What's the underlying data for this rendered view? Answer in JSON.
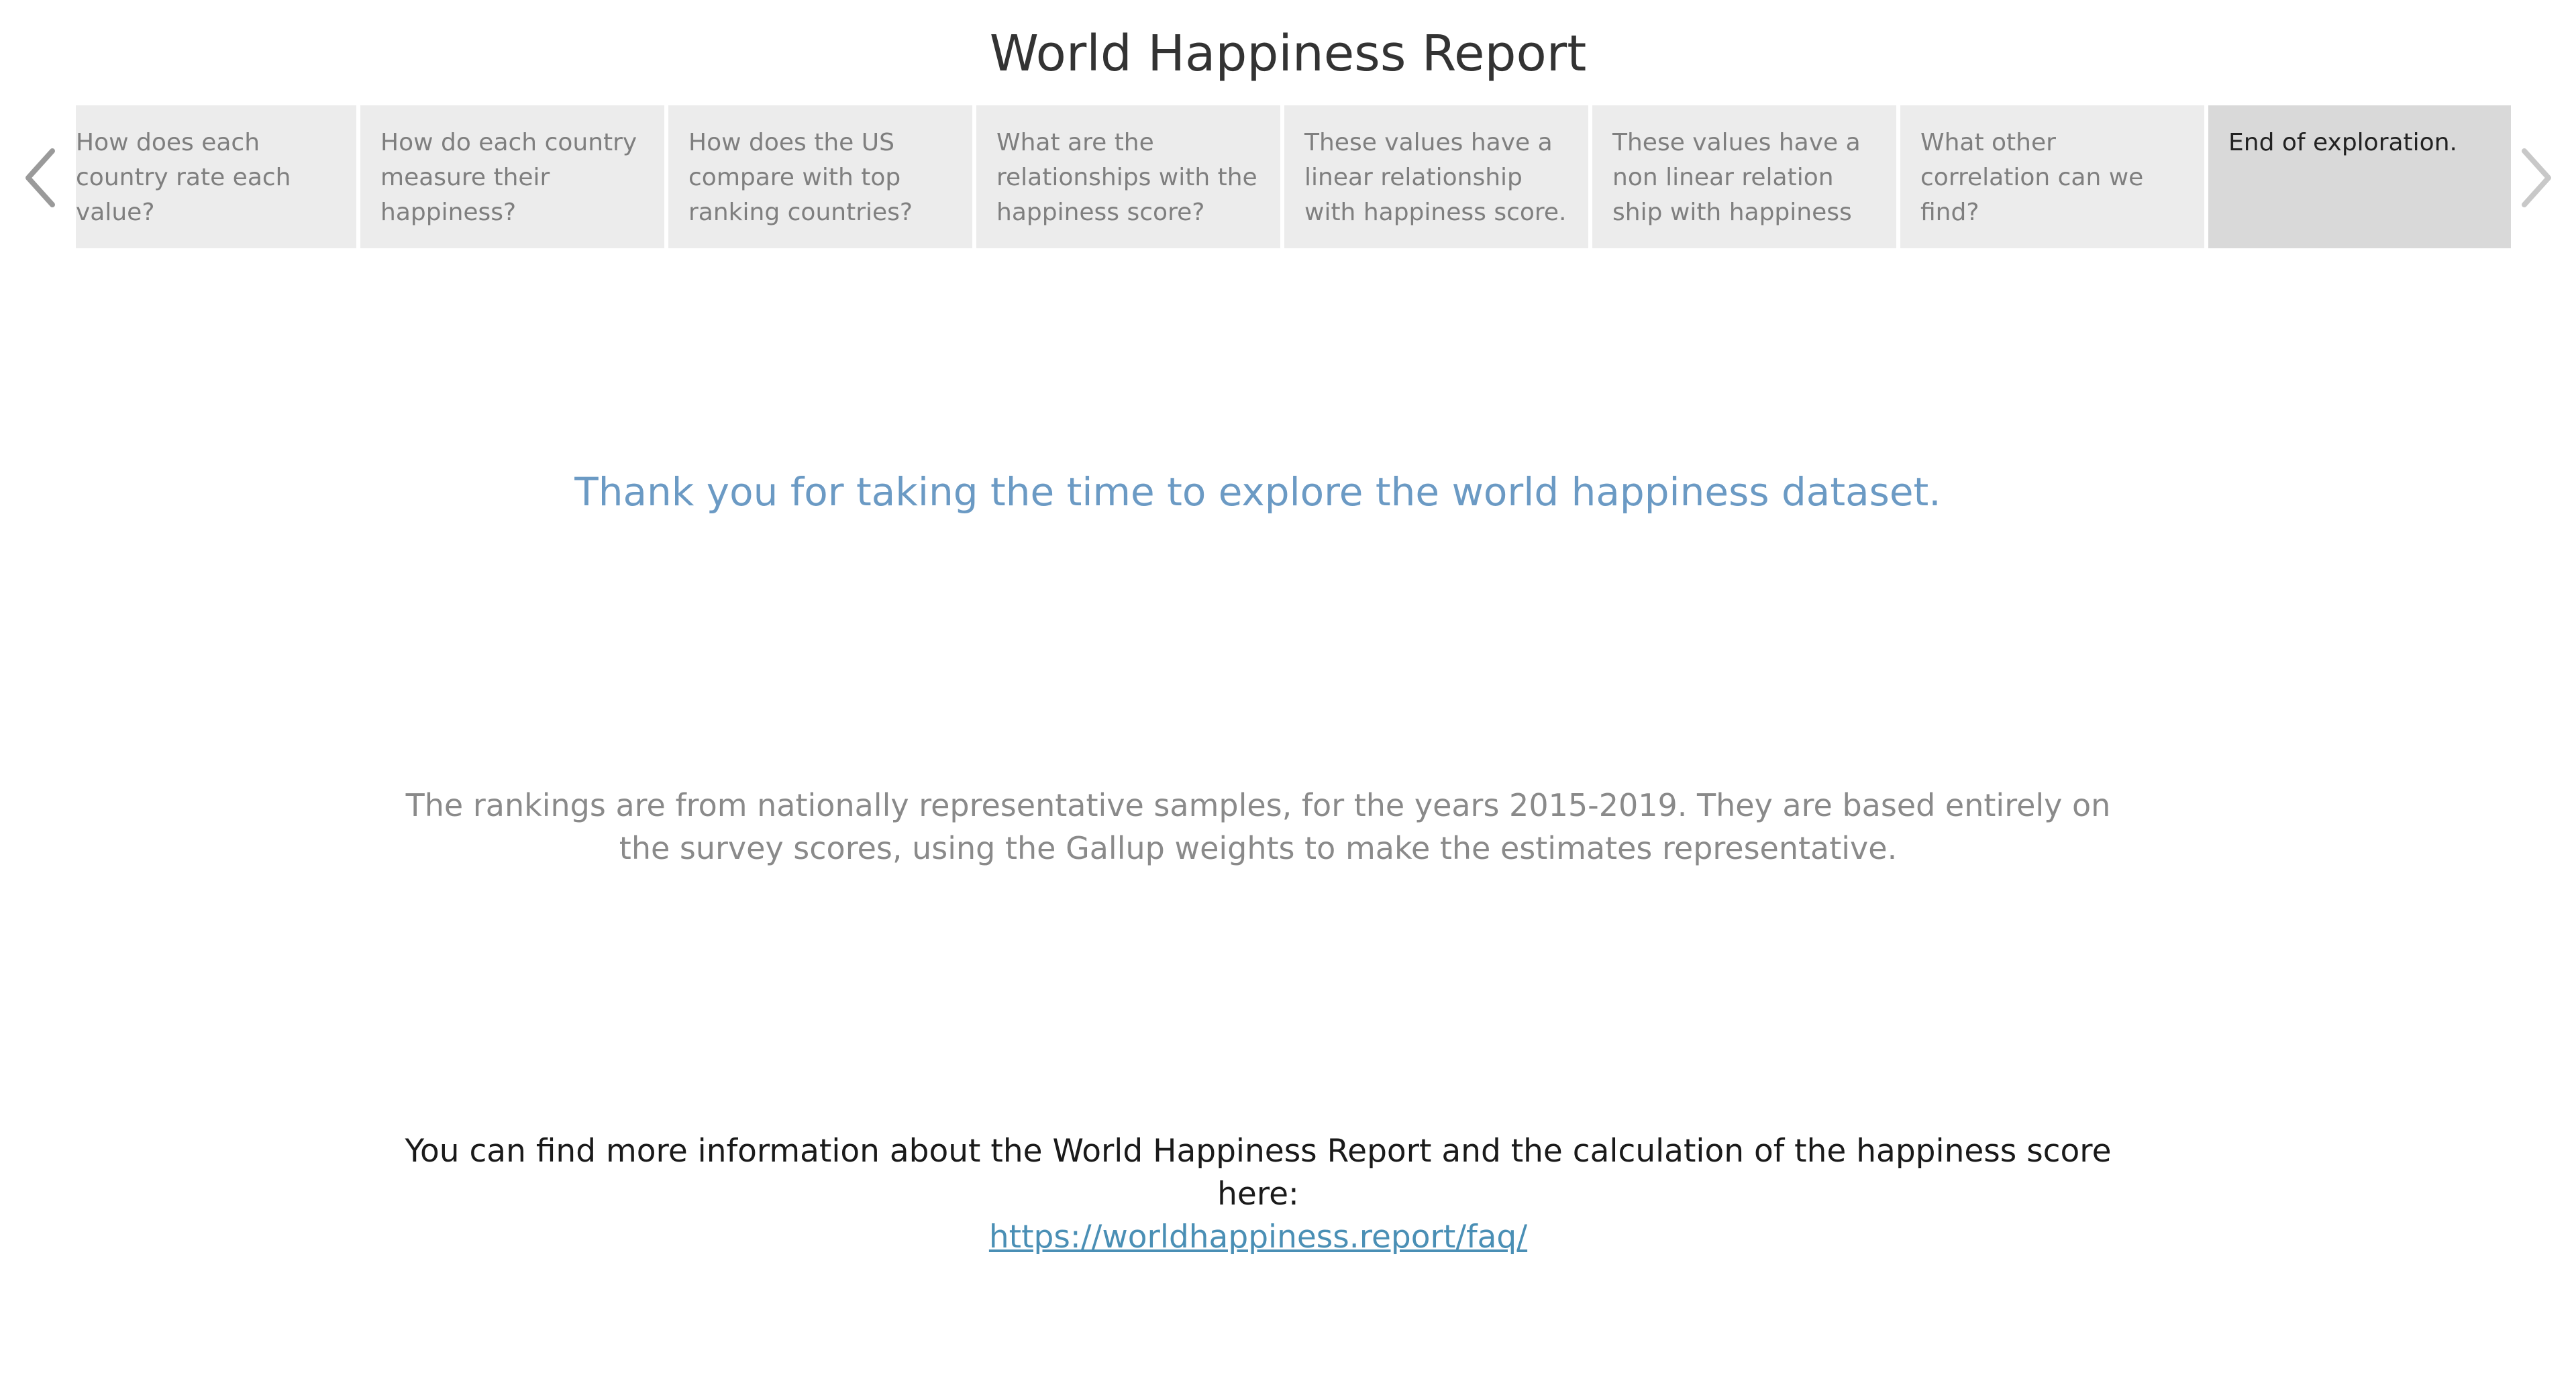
{
  "story": {
    "title": "World Happiness Report"
  },
  "navigator": {
    "prev_icon": "chevron-left-icon",
    "next_icon": "chevron-right-icon",
    "points": [
      {
        "label": "How does each country rate each value?"
      },
      {
        "label": "How do each country measure their happiness?"
      },
      {
        "label": "How does the US compare with top ranking countries?"
      },
      {
        "label": "What are the relationships with the happiness score?"
      },
      {
        "label": "These values have a linear relationship with happiness score."
      },
      {
        "label": "These values have a non linear relation ship with happiness"
      },
      {
        "label": "What other correlation can we find?"
      },
      {
        "label": "End of exploration."
      }
    ],
    "active_index": 7
  },
  "content": {
    "thank_you": "Thank you for taking the time to explore the world happiness dataset.",
    "rankings_note": "The rankings are from nationally representative samples, for the years 2015-2019. They are based entirely on the survey scores, using the Gallup weights to make the estimates representative.",
    "more_info": "You can find more information about the World Happiness Report and the calculation of the happiness score here:",
    "faq_link": "https://worldhappiness.report/faq/"
  },
  "colors": {
    "accent": "#6b9ac4",
    "link": "#4a8fb5",
    "active_tab": "#d9d9d9",
    "inactive_tab": "#ececec"
  }
}
